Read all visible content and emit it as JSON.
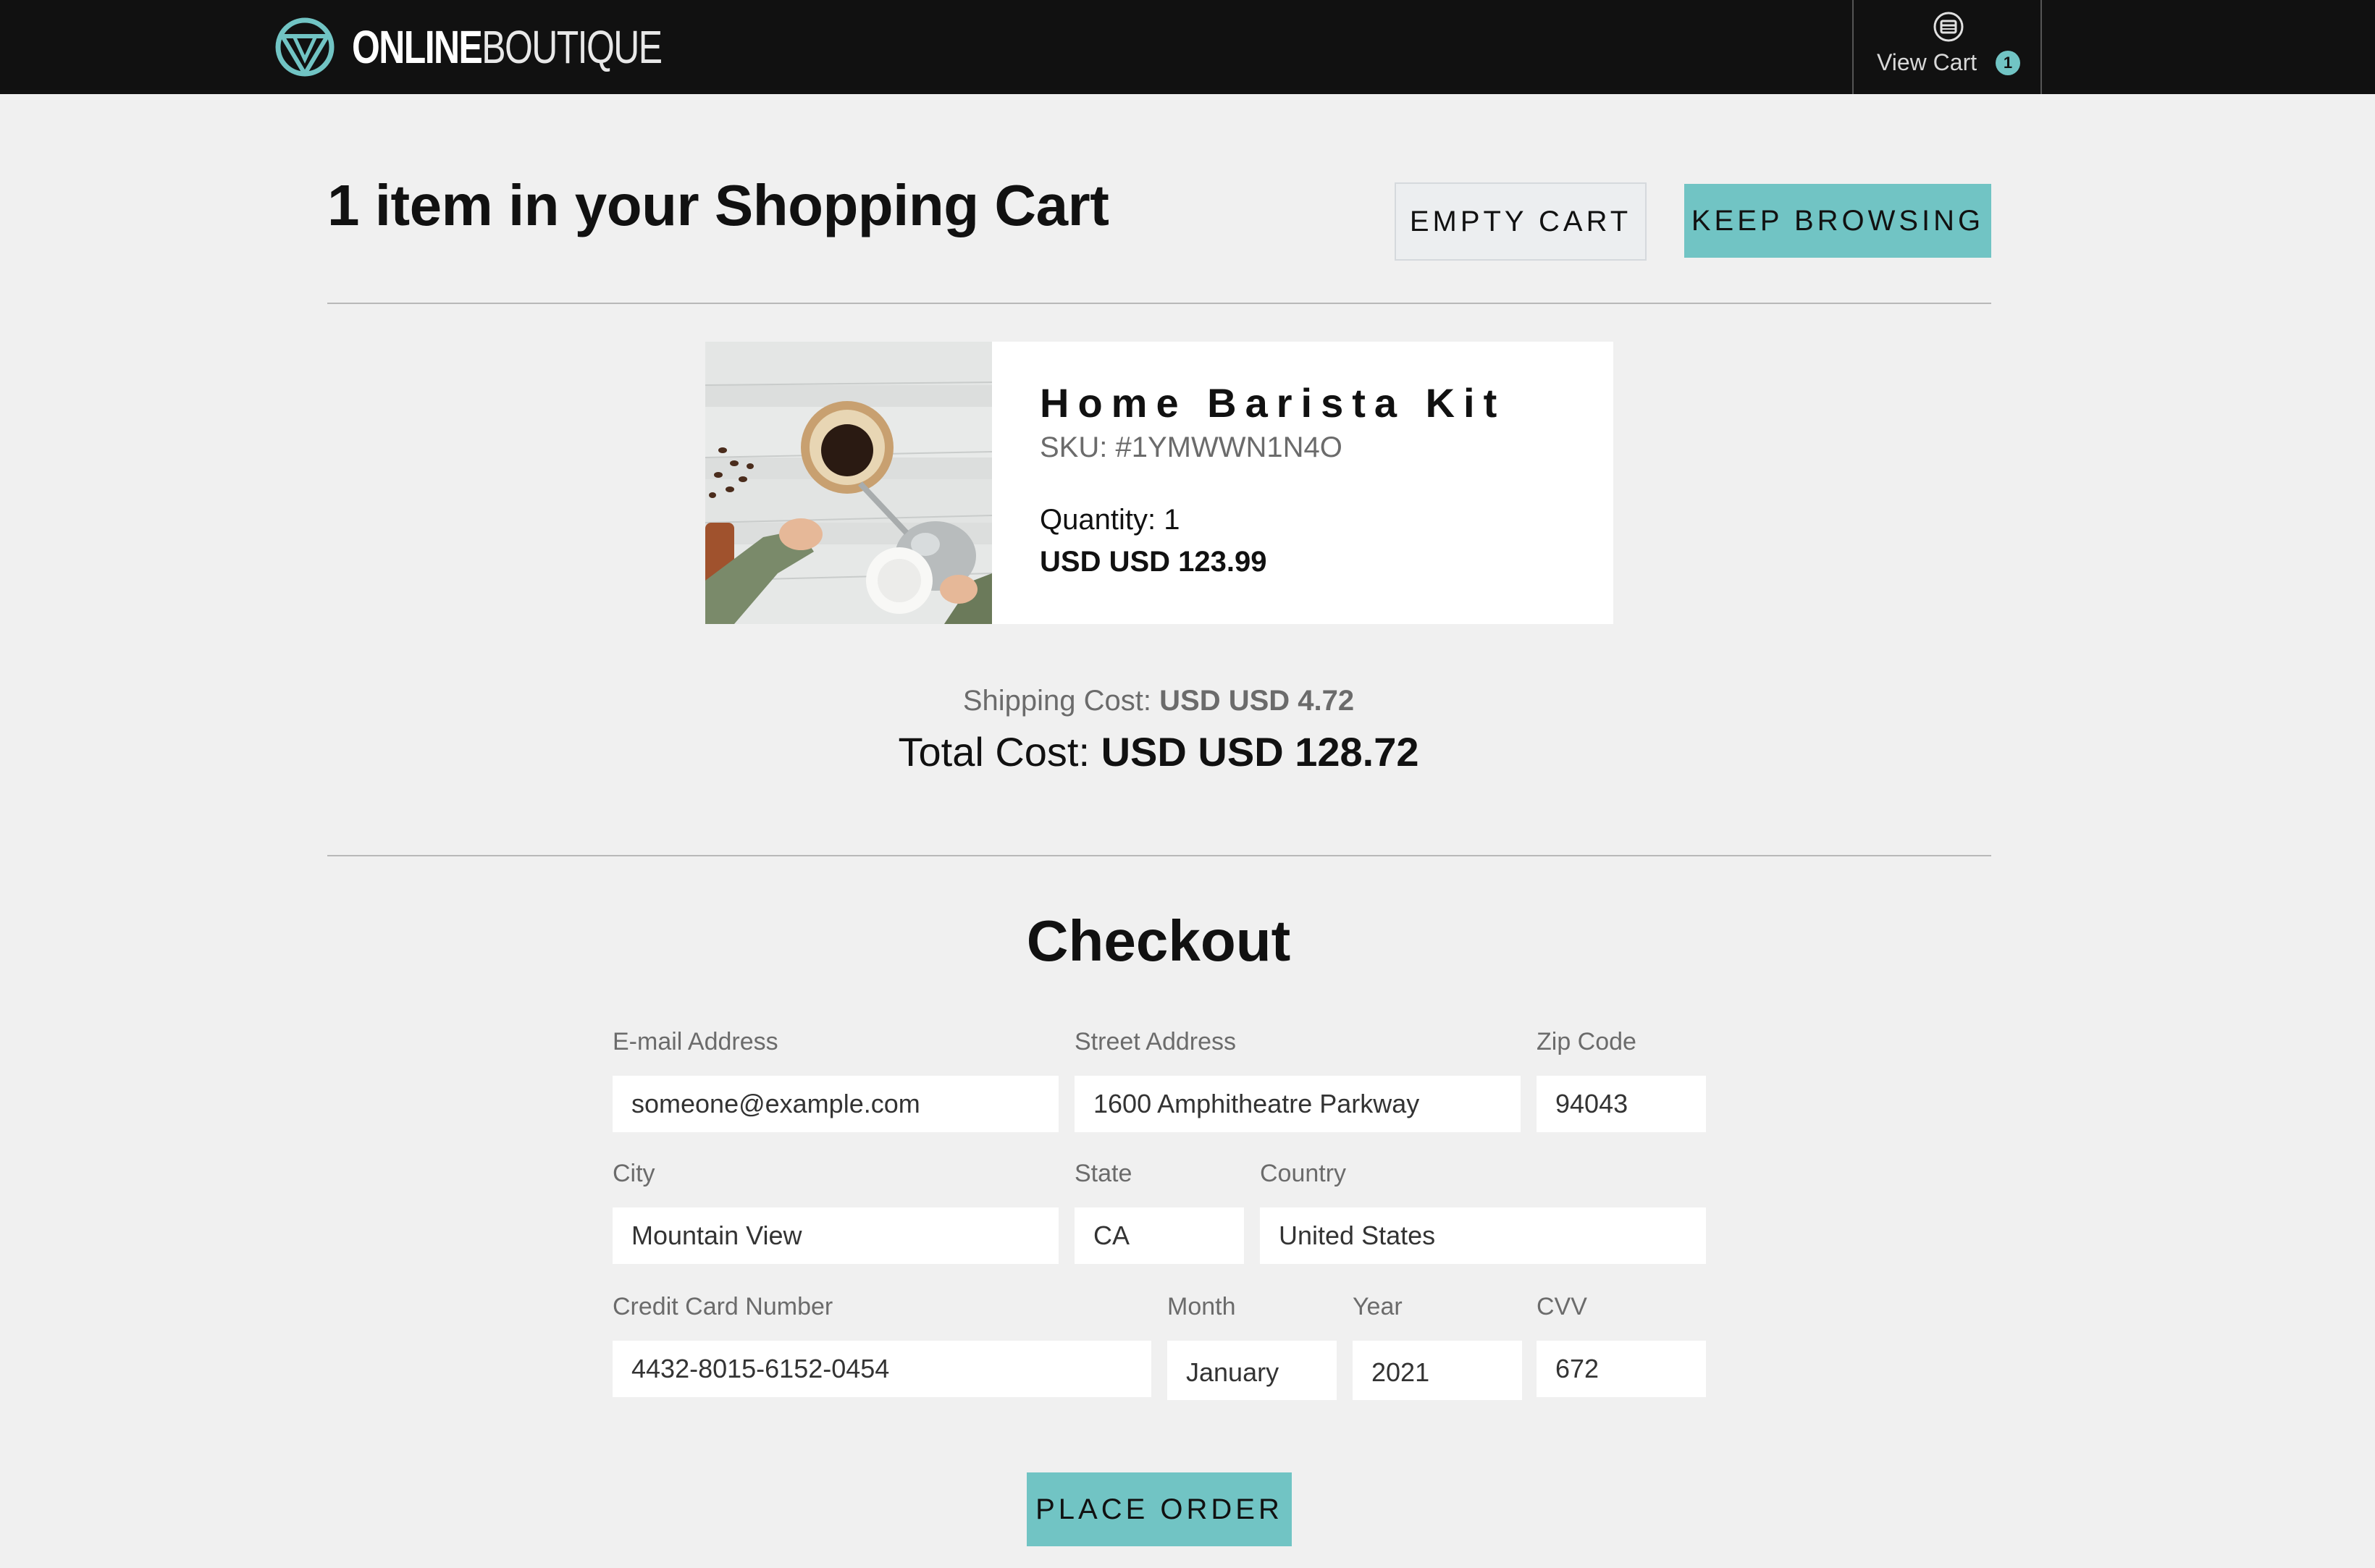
{
  "header": {
    "logo_bold": "ONLINE",
    "logo_thin": "BOUTIQUE",
    "view_cart_label": "View Cart",
    "cart_count": "1"
  },
  "cart": {
    "title": "1 item in your Shopping Cart",
    "empty_cart_label": "EMPTY CART",
    "keep_browsing_label": "KEEP BROWSING",
    "item": {
      "name": "Home Barista Kit",
      "sku": "SKU: #1YMWWN1N4O",
      "quantity": "Quantity: 1",
      "price": "USD USD 123.99"
    },
    "shipping_label": "Shipping Cost: ",
    "shipping_amount": "USD USD 4.72",
    "total_label": "Total Cost: ",
    "total_amount": "USD USD 128.72"
  },
  "checkout": {
    "title": "Checkout",
    "email_label": "E-mail Address",
    "email_value": "someone@example.com",
    "street_label": "Street Address",
    "street_value": "1600 Amphitheatre Parkway",
    "zip_label": "Zip Code",
    "zip_value": "94043",
    "city_label": "City",
    "city_value": "Mountain View",
    "state_label": "State",
    "state_value": "CA",
    "country_label": "Country",
    "country_value": "United States",
    "card_label": "Credit Card Number",
    "card_value": "4432-8015-6152-0454",
    "month_label": "Month",
    "month_value": "January",
    "year_label": "Year",
    "year_value": "2021",
    "cvv_label": "CVV",
    "cvv_value": "672",
    "place_order_label": "PLACE ORDER"
  },
  "colors": {
    "header_bg": "#111111",
    "accent": "#71c4c4",
    "page_bg": "#f0f0f0",
    "muted_text": "#6b6b6b"
  },
  "icons": {
    "logo": "boutique-logo-icon",
    "cart": "cart-icon"
  }
}
